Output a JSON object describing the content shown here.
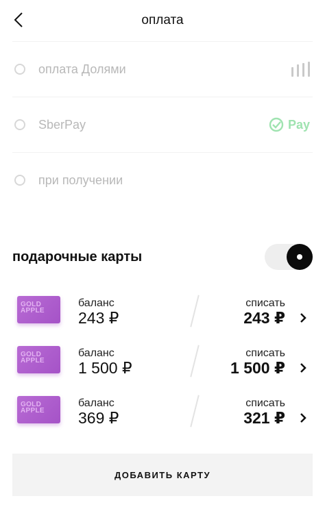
{
  "header": {
    "title": "оплата"
  },
  "payment_methods": [
    {
      "label": "оплата Долями",
      "icon": "dolyami-bars-icon",
      "selected": false
    },
    {
      "label": "SberPay",
      "badge_text": "Pay",
      "icon": "sberpay-check-icon",
      "selected": false
    },
    {
      "label": "при получении",
      "selected": false
    }
  ],
  "gift_cards": {
    "title": "подарочные карты",
    "toggle_on": true,
    "cards": [
      {
        "brand_line1": "GOLD",
        "brand_line2": "APPLE",
        "balance_label": "баланс",
        "balance_value": "243 ₽",
        "debit_label": "списать",
        "debit_value": "243 ₽"
      },
      {
        "brand_line1": "GOLD",
        "brand_line2": "APPLE",
        "balance_label": "баланс",
        "balance_value": "1 500 ₽",
        "debit_label": "списать",
        "debit_value": "1 500 ₽"
      },
      {
        "brand_line1": "GOLD",
        "brand_line2": "APPLE",
        "balance_label": "баланс",
        "balance_value": "369 ₽",
        "debit_label": "списать",
        "debit_value": "321 ₽"
      }
    ]
  },
  "add_card": {
    "label": "ДОБАВИТЬ КАРТУ"
  },
  "colors": {
    "accent": "#111111",
    "card_purple": "#b062cc",
    "sberpay_green": "#9fe3b0",
    "muted_text": "#b8b8b8"
  }
}
